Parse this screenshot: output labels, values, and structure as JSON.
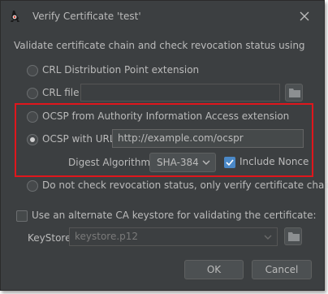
{
  "window": {
    "title": "Verify Certificate 'test'"
  },
  "group": {
    "label": "Validate certificate chain and check revocation status using"
  },
  "options": {
    "crl_dp": {
      "label": "CRL Distribution Point extension"
    },
    "crl_file": {
      "label": "CRL file",
      "value": ""
    },
    "ocsp_aia": {
      "label": "OCSP from Authority Information Access extension"
    },
    "ocsp_url": {
      "label": "OCSP with URL",
      "value": "http://example.com/ocspr"
    },
    "digest": {
      "label": "Digest Algorithm:",
      "selected": "SHA-384"
    },
    "nonce": {
      "label": "Include Nonce",
      "checked": true
    },
    "no_check": {
      "label": "Do not check revocation status, only verify certificate chain"
    }
  },
  "keystore": {
    "alternate_label": "Use an alternate CA keystore for validating the certificate:",
    "alternate_checked": false,
    "label": "KeyStore:",
    "value": "keystore.p12"
  },
  "buttons": {
    "ok": "OK",
    "cancel": "Cancel"
  },
  "colors": {
    "background": "#3c3f41",
    "text": "#bbbbbb",
    "highlight_border": "#e0161c",
    "checkbox_accent": "#4a88c7"
  },
  "icons": {
    "app": "duke-icon",
    "close": "close-icon",
    "browse": "folder-icon",
    "dropdown": "chevron-down-icon"
  }
}
